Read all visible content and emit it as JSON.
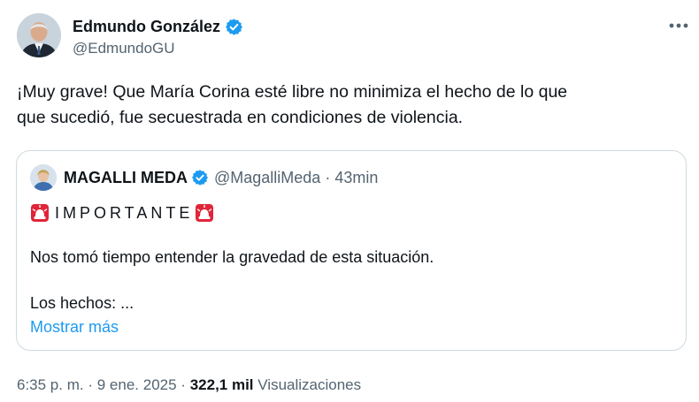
{
  "author": {
    "name": "Edmundo González",
    "handle": "@EdmundoGU"
  },
  "tweet": {
    "line1": "¡Muy grave! Que María Corina esté libre no minimiza el hecho de lo que",
    "line2": "que sucedió, fue secuestrada en condiciones de violencia."
  },
  "quote": {
    "name": "MAGALLI MEDA",
    "handle": "@MagalliMeda",
    "separator": "·",
    "time": "43min",
    "important": "IMPORTANTE",
    "line1": "Nos tomó tiempo entender la gravedad de esta situación.",
    "line2": "Los hechos: ...",
    "show_more": "Mostrar más"
  },
  "meta": {
    "time": "6:35 p. m.",
    "sep1": "·",
    "date": "9 ene. 2025",
    "sep2": "·",
    "views_count": "322,1 mil",
    "views_label": "Visualizaciones"
  },
  "colors": {
    "verified": "#1d9bf0",
    "link": "#1d9bf0",
    "secondary_text": "#536471",
    "primary_text": "#0f1419",
    "border": "#cfd9de",
    "siren": "#e0253a"
  },
  "icons": {
    "verified": "verified-badge-icon",
    "more": "more-horizontal-icon",
    "siren": "rotating-light-icon"
  }
}
